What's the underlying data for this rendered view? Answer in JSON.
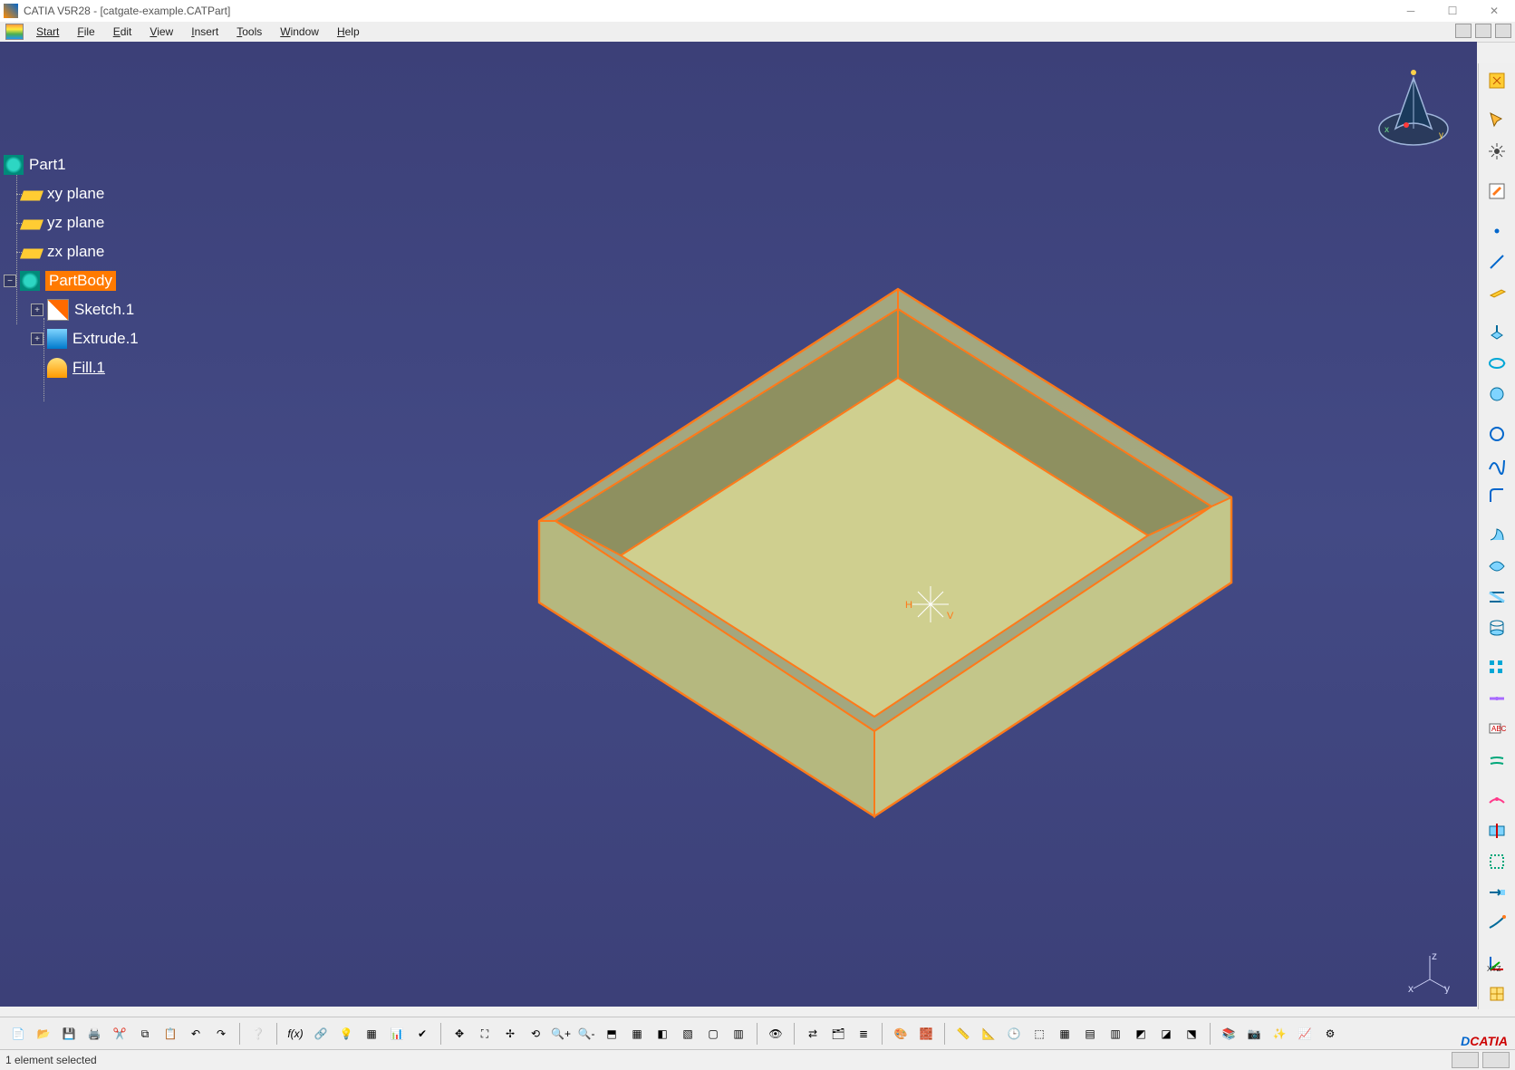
{
  "window": {
    "title": "CATIA V5R28 - [catgate-example.CATPart]"
  },
  "menu": {
    "start": "Start",
    "file": "File",
    "edit": "Edit",
    "view": "View",
    "insert": "Insert",
    "tools": "Tools",
    "window": "Window",
    "help": "Help"
  },
  "tree": {
    "root": "Part1",
    "planes": [
      "xy plane",
      "yz plane",
      "zx plane"
    ],
    "body": "PartBody",
    "children": [
      "Sketch.1",
      "Extrude.1",
      "Fill.1"
    ]
  },
  "status": {
    "text": "1 element selected"
  },
  "logo": "CATIA"
}
